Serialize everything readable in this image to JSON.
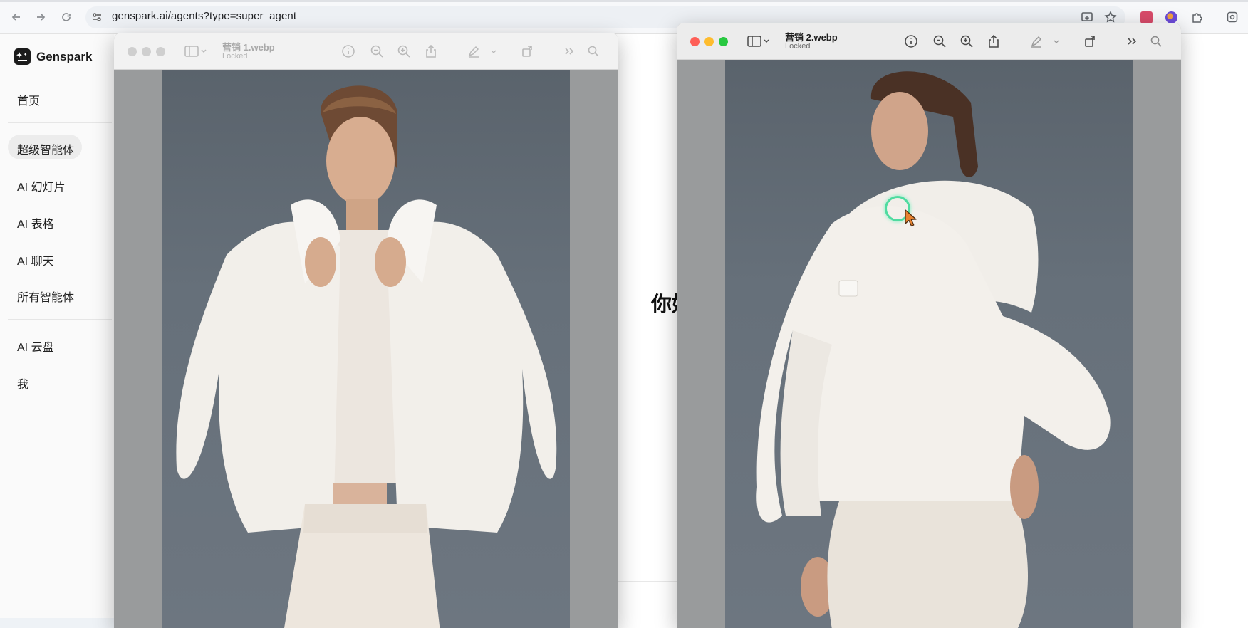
{
  "browser": {
    "url": "genspark.ai/agents?type=super_agent",
    "nav": [
      "back-icon",
      "forward-icon",
      "reload-icon"
    ],
    "extensions": [
      "cast-icon",
      "bookmark-star-icon",
      "extension-red-icon",
      "profile-icon",
      "puzzle-icon",
      "screenshot-icon"
    ]
  },
  "app": {
    "name": "Genspark",
    "greeting": "你好"
  },
  "sidebar": {
    "items": [
      {
        "label": "首页"
      },
      {
        "label": "超级智能体",
        "active": true
      },
      {
        "label": "AI 幻灯片"
      },
      {
        "label": "AI 表格"
      },
      {
        "label": "AI 聊天"
      },
      {
        "label": "所有智能体"
      },
      {
        "label": "AI 云盘"
      },
      {
        "label": "我"
      }
    ]
  },
  "windows": [
    {
      "filename": "营销 1.webp",
      "status": "Locked",
      "active": false
    },
    {
      "filename": "营销 2.webp",
      "status": "Locked",
      "active": true
    }
  ],
  "colors": {
    "traffic_red": "#fe5f57",
    "traffic_yellow": "#febc2e",
    "traffic_green": "#28c840",
    "cursor_ring": "#4fdba0",
    "cursor_fill": "#e8832f"
  }
}
